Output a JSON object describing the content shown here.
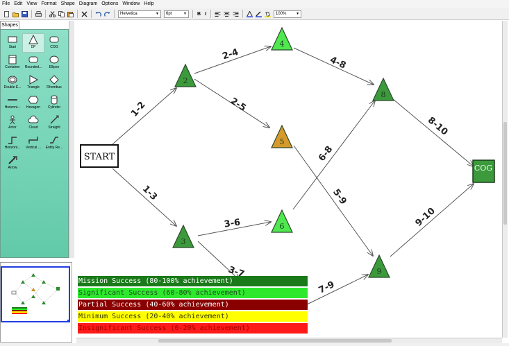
{
  "menu": [
    "File",
    "Edit",
    "View",
    "Format",
    "Shape",
    "Diagram",
    "Options",
    "Window",
    "Help"
  ],
  "toolbar": {
    "font_family": "Helvetica",
    "font_size": "6pt",
    "bold": "B",
    "italic": "I",
    "zoom": "100%"
  },
  "shapes_tab": "Shapes",
  "shapes": [
    {
      "label": "Start",
      "icon": "rectangle-icon"
    },
    {
      "label": "DP",
      "icon": "triangle-outline-icon"
    },
    {
      "label": "COG",
      "icon": "rounded-rectangle-icon"
    },
    {
      "label": "Container",
      "icon": "container-icon"
    },
    {
      "label": "Rounded...",
      "icon": "rounded-rectangle-icon"
    },
    {
      "label": "Ellipse",
      "icon": "ellipse-icon"
    },
    {
      "label": "Double E...",
      "icon": "double-ellipse-icon"
    },
    {
      "label": "Triangle",
      "icon": "triangle-icon"
    },
    {
      "label": "Rhombus",
      "icon": "rhombus-icon"
    },
    {
      "label": "Horizont...",
      "icon": "horizontal-line-icon"
    },
    {
      "label": "Hexagon",
      "icon": "hexagon-icon"
    },
    {
      "label": "Cylinder",
      "icon": "cylinder-icon"
    },
    {
      "label": "Actor",
      "icon": "actor-icon"
    },
    {
      "label": "Cloud",
      "icon": "cloud-icon"
    },
    {
      "label": "Straight",
      "icon": "straight-edge-icon"
    },
    {
      "label": "Horizont...",
      "icon": "horizontal-edge-icon"
    },
    {
      "label": "Vertical ...",
      "icon": "vertical-edge-icon"
    },
    {
      "label": "Entity Re...",
      "icon": "entity-relation-icon"
    },
    {
      "label": "Arrow",
      "icon": "arrow-icon"
    }
  ],
  "diagram": {
    "nodes": [
      {
        "id": "start",
        "label": "START",
        "kind": "start"
      },
      {
        "id": "n2",
        "label": "2",
        "color": "#3c9a3c"
      },
      {
        "id": "n3",
        "label": "3",
        "color": "#3c9a3c"
      },
      {
        "id": "n4",
        "label": "4",
        "color": "#4fe84f"
      },
      {
        "id": "n5",
        "label": "5",
        "color": "#d69a2c"
      },
      {
        "id": "n6",
        "label": "6",
        "color": "#4fe84f"
      },
      {
        "id": "n8",
        "label": "8",
        "color": "#3c9a3c"
      },
      {
        "id": "n9",
        "label": "9",
        "color": "#3c9a3c"
      },
      {
        "id": "cog",
        "label": "COG",
        "kind": "cog",
        "color": "#3c9a3c"
      }
    ],
    "edges": [
      {
        "label": "1-2"
      },
      {
        "label": "1-3"
      },
      {
        "label": "2-4"
      },
      {
        "label": "2-5"
      },
      {
        "label": "3-6"
      },
      {
        "label": "3-7"
      },
      {
        "label": "4-8"
      },
      {
        "label": "5-9"
      },
      {
        "label": "6-8"
      },
      {
        "label": "7-9"
      },
      {
        "label": "8-10"
      },
      {
        "label": "9-10"
      }
    ]
  },
  "legend": [
    {
      "label": "Mission Success (80-100% achievement)",
      "bg": "#1a7a1a",
      "fg": "#ffffff"
    },
    {
      "label": "Significant Success (60-80% achievement)",
      "bg": "#2ee82e",
      "fg": "#1a4a1a"
    },
    {
      "label": "Partial Success (40-60% achievement)",
      "bg": "#8a0000",
      "fg": "#ffffff"
    },
    {
      "label": "Minimum Success (20-40% achievement)",
      "bg": "#ffff00",
      "fg": "#333300"
    },
    {
      "label": "Insignificant Success (0-20% achievement)",
      "bg": "#ff1a1a",
      "fg": "#a00000"
    }
  ]
}
